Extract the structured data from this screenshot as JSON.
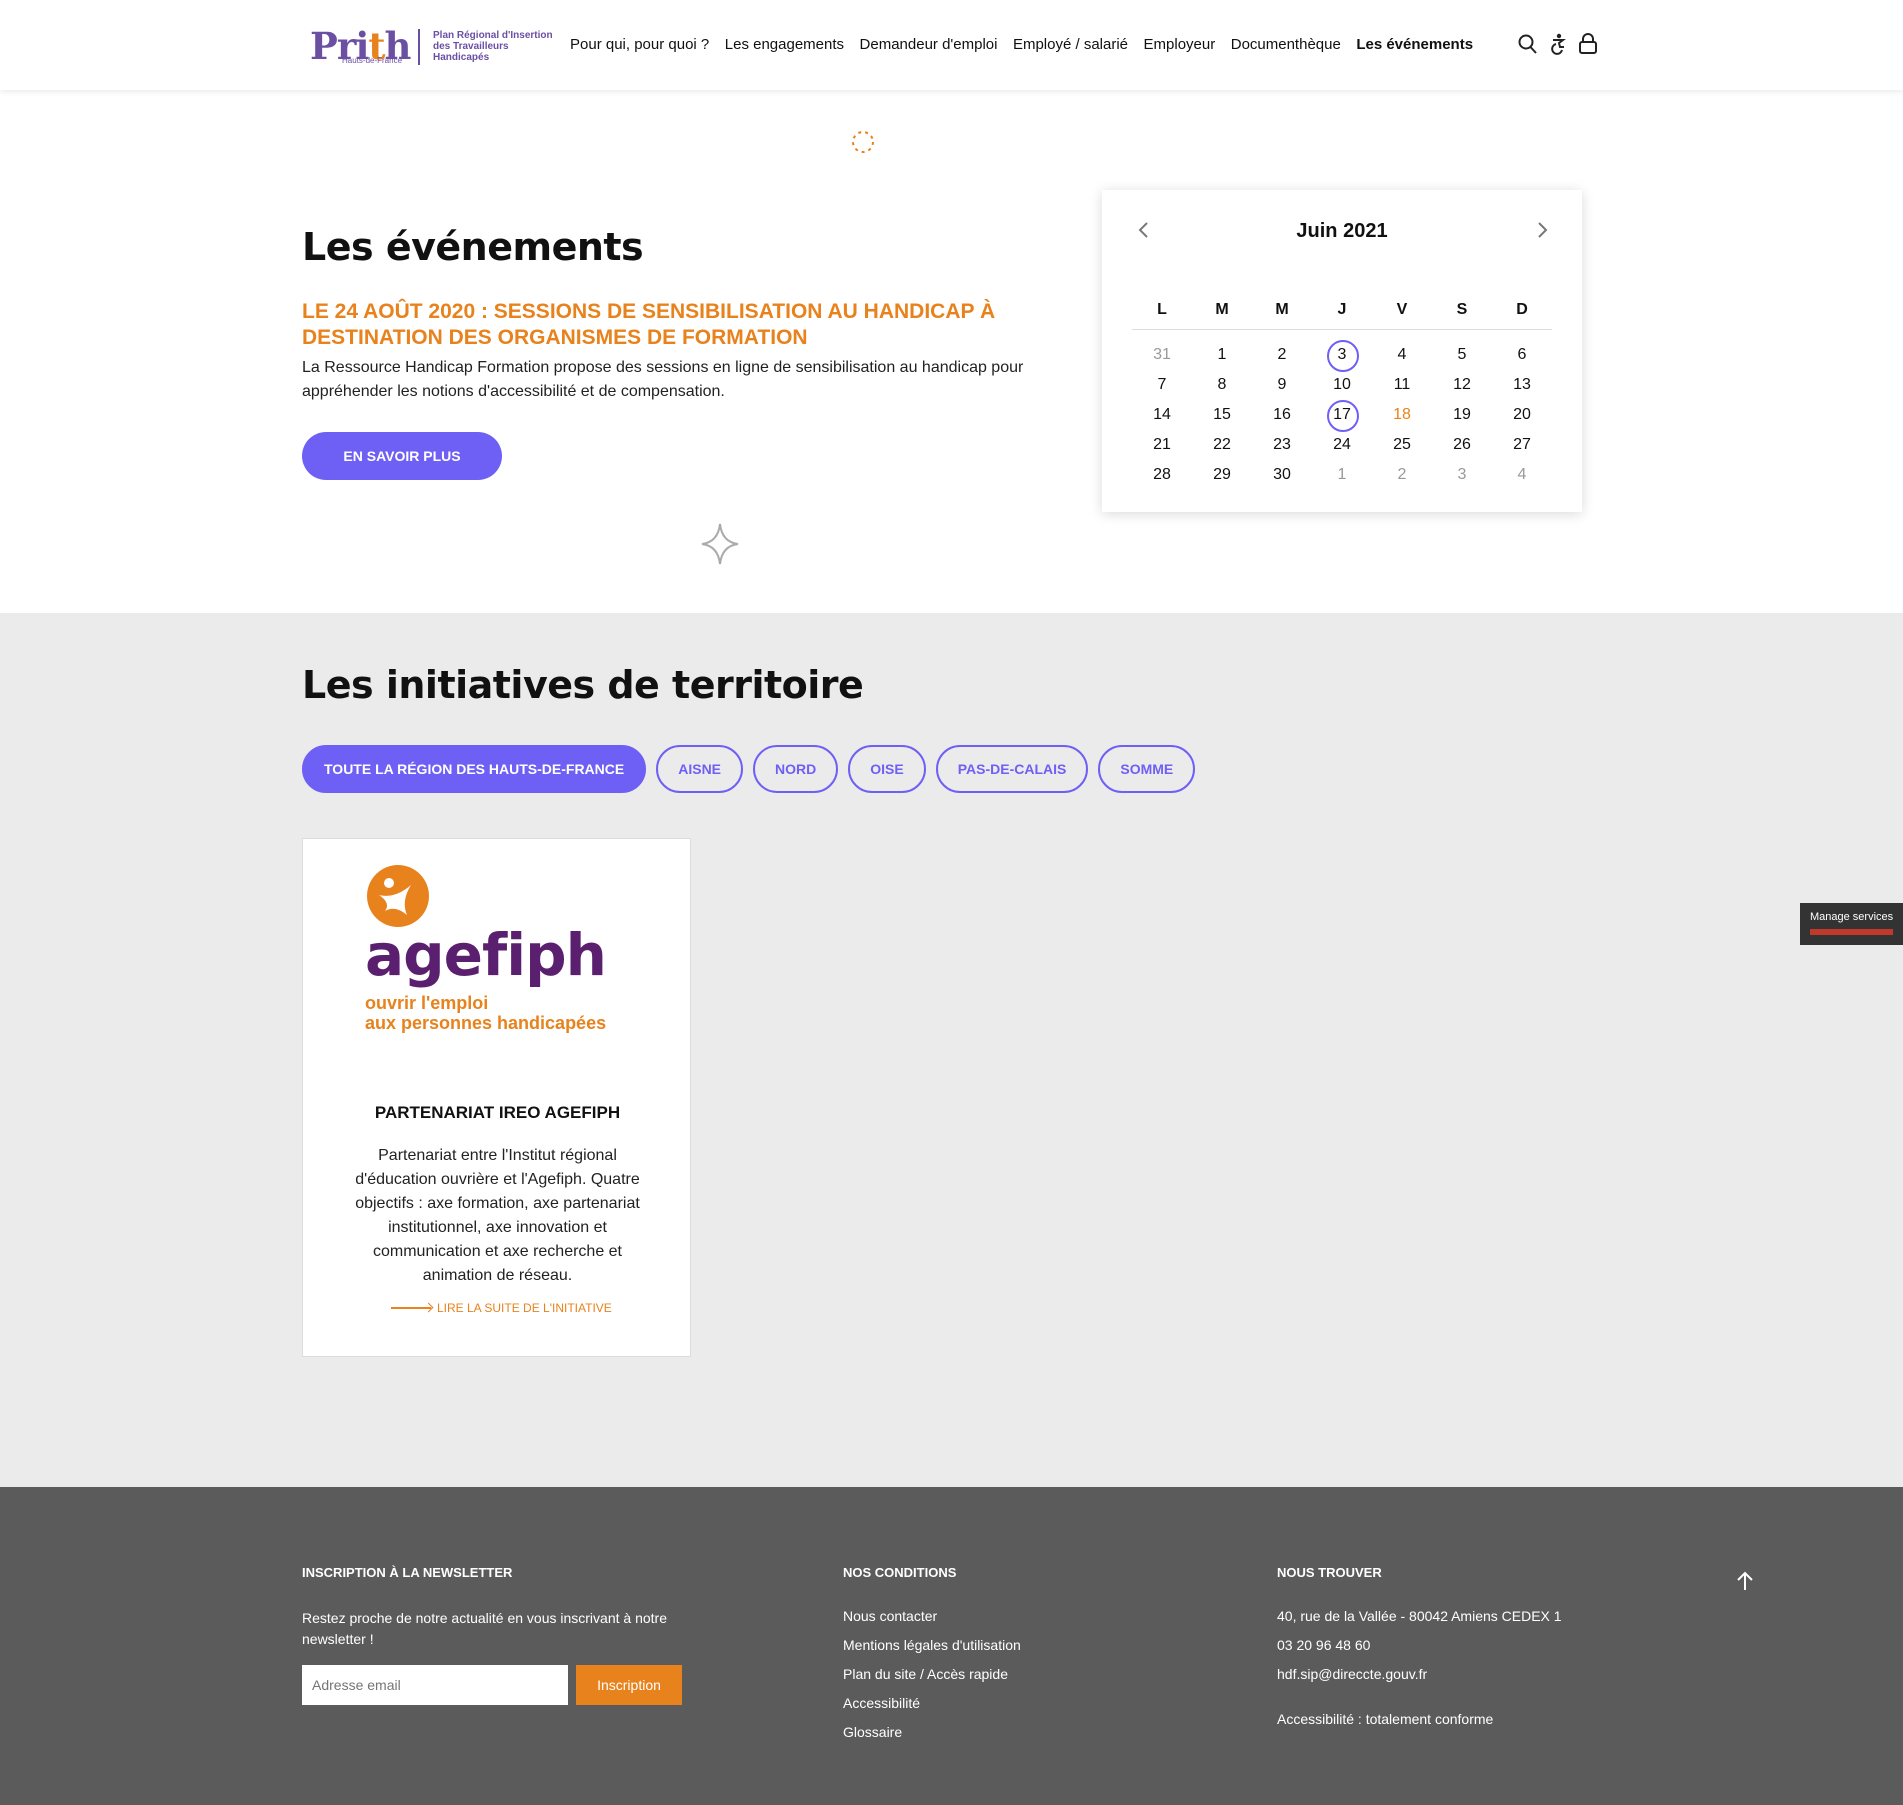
{
  "header": {
    "logo_word_p": "Pri",
    "logo_word_t": "t",
    "logo_word_h": "h",
    "logo_sub": "Hauts-de-France",
    "logo_text": "Plan Régional d'Insertion des Travailleurs Handicapés",
    "nav": [
      "Pour qui, pour quoi ?",
      "Les engagements",
      "Demandeur d'emploi",
      "Employé / salarié",
      "Employeur",
      "Documenthèque",
      "Les événements"
    ],
    "icons": [
      "search-icon",
      "accessibility-icon",
      "lock-icon"
    ]
  },
  "events": {
    "title": "Les événements",
    "headline": "LE 24 AOÛT 2020 : SESSIONS DE SENSIBILISATION AU HANDICAP À DESTINATION DES ORGANISMES DE FORMATION",
    "description": "La Ressource Handicap Formation propose des sessions en ligne de sensibilisation au handicap pour appréhender les notions d'accessibilité et de compensation.",
    "button": "EN SAVOIR PLUS"
  },
  "calendar": {
    "title": "Juin 2021",
    "days": [
      "L",
      "M",
      "M",
      "J",
      "V",
      "S",
      "D"
    ],
    "weeks": [
      [
        "31",
        "1",
        "2",
        "3",
        "4",
        "5",
        "6"
      ],
      [
        "7",
        "8",
        "9",
        "10",
        "11",
        "12",
        "13"
      ],
      [
        "14",
        "15",
        "16",
        "17",
        "18",
        "19",
        "20"
      ],
      [
        "21",
        "22",
        "23",
        "24",
        "25",
        "26",
        "27"
      ],
      [
        "28",
        "29",
        "30",
        "1",
        "2",
        "3",
        "4"
      ]
    ],
    "accent": "#6e5ff5",
    "highlight": "#e8821c"
  },
  "initiatives": {
    "title": "Les initiatives de territoire",
    "filters": [
      "TOUTE LA RÉGION DES HAUTS-DE-FRANCE",
      "AISNE",
      "NORD",
      "OISE",
      "PAS-DE-CALAIS",
      "SOMME"
    ],
    "card": {
      "logo_name": "agefiph",
      "logo_tagline_1": "ouvrir l'emploi",
      "logo_tagline_2": "aux personnes handicapées",
      "title": "PARTENARIAT IREO AGEFIPH",
      "description": "Partenariat entre l'Institut régional d'éducation ouvrière et l'Agefiph. Quatre objectifs : axe formation, axe partenariat institutionnel, axe innovation et communication et axe recherche et animation de réseau.",
      "link": "LIRE LA SUITE DE L'INITIATIVE"
    }
  },
  "manage_services": "Manage services",
  "footer": {
    "newsletter_title": "INSCRIPTION À LA NEWSLETTER",
    "newsletter_text": "Restez proche de notre actualité en vous inscrivant à notre newsletter !",
    "email_placeholder": "Adresse email",
    "subscribe": "Inscription",
    "conditions_title": "NOS CONDITIONS",
    "conditions_links": [
      "Nous contacter",
      "Mentions légales d'utilisation",
      "Plan du site / Accès rapide",
      "Accessibilité",
      "Glossaire"
    ],
    "find_title": "NOUS TROUVER",
    "address": "40, rue de la Vallée - 80042 Amiens CEDEX 1",
    "phone": "03 20 96 48 60",
    "email": "hdf.sip@direccte.gouv.fr",
    "accessibility": "Accessibilité : totalement conforme"
  },
  "colors": {
    "brand_purple": "#6b4fa3",
    "button": "#6e5ff5",
    "orange": "#e8821c",
    "footer_bg": "#5b5b5b",
    "section_bg": "#ebebeb"
  }
}
